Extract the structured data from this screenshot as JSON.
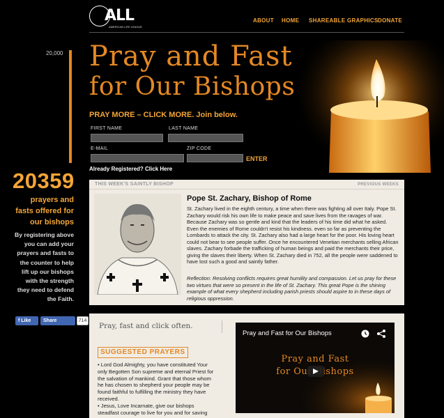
{
  "header": {
    "logo_text": "ALL",
    "logo_subtext": "AMERICAN LIFE LEAGUE",
    "nav": [
      "ABOUT",
      "HOME",
      "SHAREABLE GRAPHICS",
      "DONATE"
    ]
  },
  "counter": {
    "goal": "20,000",
    "count": "20359",
    "fill_fraction": 1.0,
    "label": "prayers and fasts offered for our bishops",
    "description": "By registering above you can add your prayers and fasts to the counter to help lift up our bishops with the strength they need to defend the Faith."
  },
  "social": {
    "like": "Like",
    "share": "Share",
    "share_count": "714"
  },
  "hero": {
    "title_line1": "Pray and Fast",
    "title_line2": "for Our Bishops",
    "cta": "PRAY MORE – CLICK MORE.",
    "cta_sub": "Join below."
  },
  "form": {
    "first_name": "FIRST NAME",
    "last_name": "LAST NAME",
    "email": "E-MAIL",
    "zip": "ZIP CODE",
    "submit": "ENTER",
    "registered": "Already Registered? Click Here"
  },
  "saint": {
    "header_left": "THIS WEEK'S SAINTLY BISHOP",
    "header_right": "PREVIOUS WEEKS",
    "name": "Pope St. Zachary, Bishop of Rome",
    "bio": "St. Zachary lived in the eighth century, a time when there was fighting all over Italy. Pope St. Zachary would risk his own life to make peace and save lives from the ravages of war.  Because Zachary was so gentle and kind that the leaders of his time did what he asked. Even the enemies of Rome couldn't resist his kindness. even so far as preventing the Lombards to attack the city.  St. Zachary also had a large heart for the poor. His loving heart could not bear to see people suffer. Once he encountered Venetian merchants selling African slaves. Zachary forbade the trafficking of human beings and paid the merchants their price, giving the slaves their liberty. When St. Zachary died in 752, all the people were saddened to have lost such a good and saintly father.",
    "reflection": "Reflection: Resolving conflicts requires great humility and compassion. Let us pray for these two virtues that were so present in the life of St. Zachary.  This great Pope is the shining example of what every shepherd including parish priests should aspire to in these days of religious oppression."
  },
  "lower": {
    "heading": "Pray, fast and click often.",
    "suggested": "SUGGESTED PRAYERS",
    "prayer1": "• Lord God Almighty, you have constituted Your only Begotten Son supreme and eternal Priest for the salvation of mankind. Grant that those whom he has chosen to shepherd your people may be found faithful to fulfilling the ministry they have received.",
    "prayer2": "• Jesus, Love Incarnate, give our bishops steadfast courage to live for you and for saving"
  },
  "video": {
    "title": "Pray and Fast for Our Bishops",
    "overlay_line1": "Pray and Fast",
    "overlay_line2": "for Our Bishops"
  }
}
